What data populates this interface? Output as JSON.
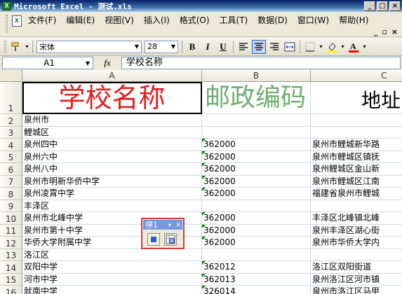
{
  "window": {
    "app_icon": "excel-icon",
    "title": "Microsoft Excel - 测试.xls",
    "controls": [
      "_",
      "□",
      "×"
    ]
  },
  "menu": {
    "items": [
      "文件(F)",
      "编辑(E)",
      "视图(V)",
      "插入(I)",
      "格式(O)",
      "工具(T)",
      "数据(D)",
      "窗口(W)",
      "帮助(H)"
    ],
    "doc_controls": [
      "_",
      "▫",
      "×"
    ]
  },
  "toolbar": {
    "font_name": "宋体",
    "font_size": "28",
    "bold": "B",
    "italic": "I",
    "underline": "U",
    "icons": [
      "format-painter-icon",
      "align-left-icon",
      "align-center-icon",
      "align-right-icon",
      "merge-center-icon",
      "borders-icon",
      "fill-color-icon",
      "font-color-icon"
    ],
    "font_color_letter": "A",
    "accent_fill": "#ffff00",
    "accent_font": "#ff0000"
  },
  "formula_bar": {
    "cell_ref": "A1",
    "fx": "fx",
    "content": "学校名称"
  },
  "sheet": {
    "columns": [
      "A",
      "B",
      "C"
    ],
    "header_row": {
      "a": "学校名称",
      "b": "邮政编码",
      "c": "地址",
      "a_color": "#e02020",
      "b_color": "#6fae6f"
    },
    "rows": [
      {
        "n": "1"
      },
      {
        "n": "2",
        "a": "泉州市",
        "b": "",
        "c": ""
      },
      {
        "n": "3",
        "a": "鲤城区",
        "b": "",
        "c": ""
      },
      {
        "n": "4",
        "a": "泉州四中",
        "b": "362000",
        "c": "泉州市鲤城新华路"
      },
      {
        "n": "5",
        "a": "泉州六中",
        "b": "362000",
        "c": "泉州市鲤城区镇抚"
      },
      {
        "n": "6",
        "a": "泉州八中",
        "b": "362000",
        "c": "泉州鲤城区金山新"
      },
      {
        "n": "7",
        "a": "泉州市明新华侨中学",
        "b": "362000",
        "c": "泉州市鲤城区江南"
      },
      {
        "n": "8",
        "a": "泉州凌霄中学",
        "b": "362000",
        "c": "福建省泉州市鲤城"
      },
      {
        "n": "9",
        "a": "丰泽区",
        "b": "",
        "c": ""
      },
      {
        "n": "10",
        "a": "泉州市北峰中学",
        "b": "362000",
        "c": "丰泽区北峰镇北峰"
      },
      {
        "n": "11",
        "a": "泉州市第十中学",
        "b": "362000",
        "c": "泉州丰泽区湖心街"
      },
      {
        "n": "12",
        "a": "华侨大学附属中学",
        "b": "362000",
        "c": "泉州市华侨大学内"
      },
      {
        "n": "13",
        "a": "洛江区",
        "b": "",
        "c": ""
      },
      {
        "n": "14",
        "a": "双阳中学",
        "b": "362012",
        "c": "洛江区双阳街道"
      },
      {
        "n": "15",
        "a": "河市中学",
        "b": "362013",
        "c": "泉州洛江区河市镇"
      },
      {
        "n": "16",
        "a": "就南中学",
        "b": "326014",
        "c": "泉州市洛江区马甲"
      }
    ]
  },
  "stop_recording": {
    "title": "停1",
    "close": "×",
    "buttons": [
      "stop-recording-icon",
      "relative-reference-icon"
    ]
  }
}
